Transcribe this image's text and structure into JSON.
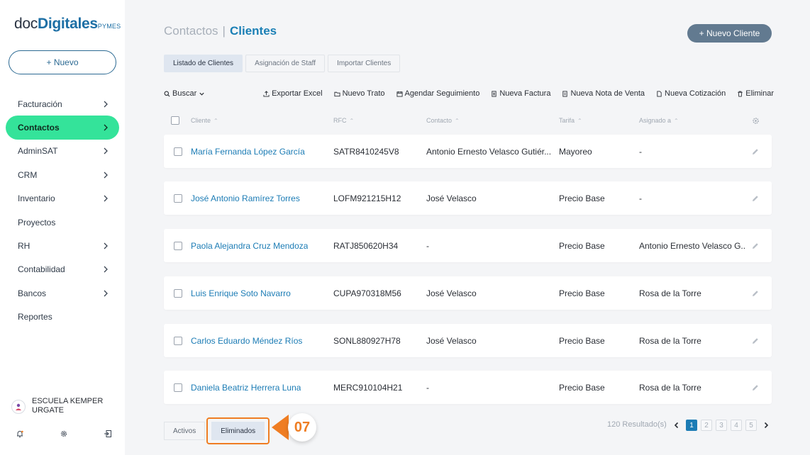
{
  "logo": {
    "pre": "doc",
    "bold": "Digitales",
    "small": "PYMES"
  },
  "sidebar": {
    "new_label": "+ Nuevo",
    "items": [
      {
        "label": "Facturación",
        "chevron": true,
        "active": false
      },
      {
        "label": "Contactos",
        "chevron": true,
        "active": true
      },
      {
        "label": "AdminSAT",
        "chevron": true,
        "active": false
      },
      {
        "label": "CRM",
        "chevron": true,
        "active": false
      },
      {
        "label": "Inventario",
        "chevron": true,
        "active": false
      },
      {
        "label": "Proyectos",
        "chevron": false,
        "active": false
      },
      {
        "label": "RH",
        "chevron": true,
        "active": false
      },
      {
        "label": "Contabilidad",
        "chevron": true,
        "active": false
      },
      {
        "label": "Bancos",
        "chevron": true,
        "active": false
      },
      {
        "label": "Reportes",
        "chevron": false,
        "active": false
      }
    ],
    "user_name": "ESCUELA KEMPER URGATE",
    "footer_icons": [
      "bell-icon",
      "gear-icon",
      "logout-icon"
    ]
  },
  "header": {
    "crumb_parent": "Contactos",
    "crumb_sep": "|",
    "crumb_current": "Clientes",
    "new_client_label": "+ Nuevo Cliente"
  },
  "tabs": [
    "Listado de Clientes",
    "Asignación de Staff",
    "Importar Clientes"
  ],
  "toolbar": {
    "search_label": "Buscar",
    "actions": [
      {
        "label": "Exportar Excel",
        "icon": "export-icon"
      },
      {
        "label": "Nuevo Trato",
        "icon": "folder-icon"
      },
      {
        "label": "Agendar Seguimiento",
        "icon": "calendar-icon"
      },
      {
        "label": "Nueva Factura",
        "icon": "invoice-icon"
      },
      {
        "label": "Nueva Nota de Venta",
        "icon": "note-icon"
      },
      {
        "label": "Nueva Cotización",
        "icon": "document-icon"
      },
      {
        "label": "Eliminar",
        "icon": "trash-icon"
      }
    ]
  },
  "table": {
    "headers": [
      "Cliente",
      "RFC",
      "Contacto",
      "Tarifa",
      "Asignado a"
    ],
    "rows": [
      {
        "cliente": "María Fernanda López García",
        "rfc": "SATR8410245V8",
        "contacto": "Antonio Ernesto Velasco Gutiér...",
        "tarifa": "Mayoreo",
        "asignado": "-"
      },
      {
        "cliente": "José Antonio Ramírez Torres",
        "rfc": "LOFM921215H12",
        "contacto": "José Velasco",
        "tarifa": "Precio Base",
        "asignado": "-"
      },
      {
        "cliente": "Paola Alejandra Cruz Mendoza",
        "rfc": "RATJ850620H34",
        "contacto": "-",
        "tarifa": "Precio Base",
        "asignado": "Antonio Ernesto Velasco G..."
      },
      {
        "cliente": "Luis Enrique Soto Navarro",
        "rfc": "CUPA970318M56",
        "contacto": "José Velasco",
        "tarifa": "Precio Base",
        "asignado": "Rosa de la Torre"
      },
      {
        "cliente": "Carlos Eduardo Méndez Ríos",
        "rfc": "SONL880927H78",
        "contacto": "José Velasco",
        "tarifa": "Precio Base",
        "asignado": "Rosa de la Torre"
      },
      {
        "cliente": "Daniela Beatriz Herrera Luna",
        "rfc": "MERC910104H21",
        "contacto": "-",
        "tarifa": "Precio Base",
        "asignado": "Rosa de la Torre"
      }
    ]
  },
  "footer": {
    "activos_label": "Activos",
    "eliminados_label": "Eliminados",
    "callout_number": "07",
    "results_label": "120 Resultado(s)",
    "pages": [
      "1",
      "2",
      "3",
      "4",
      "5"
    ],
    "current_page": "1"
  },
  "colors": {
    "accent": "#1c7cb5",
    "active_nav": "#34e39a",
    "callout": "#ef7d22",
    "button": "#627a90"
  }
}
